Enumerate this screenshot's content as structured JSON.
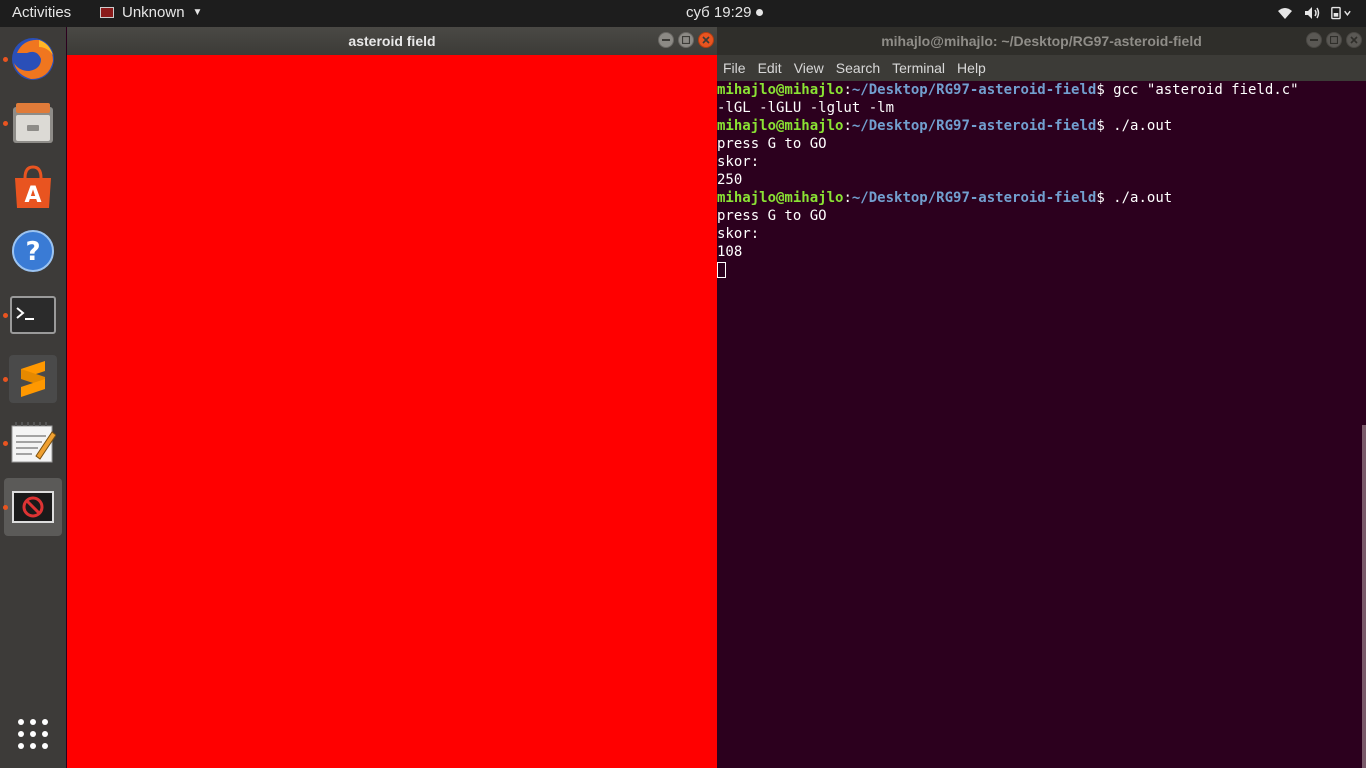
{
  "topbar": {
    "activities": "Activities",
    "app_menu_label": "Unknown",
    "clock": "суб 19:29",
    "tray_icons": [
      "wifi-icon",
      "volume-icon",
      "system-menu-icon"
    ]
  },
  "dock": {
    "items": [
      "firefox-icon",
      "files-icon",
      "software-center-icon",
      "help-icon",
      "terminal-icon",
      "sublime-text-icon",
      "text-editor-icon",
      "unknown-app-icon"
    ],
    "show_apps_icon": "app-grid-icon"
  },
  "game_window": {
    "title": "asteroid field",
    "canvas_color": "#ff0000"
  },
  "terminal": {
    "title": "mihajlo@mihajlo: ~/Desktop/RG97-asteroid-field",
    "menu": [
      "File",
      "Edit",
      "View",
      "Search",
      "Terminal",
      "Help"
    ],
    "prompt_user": "mihajlo@mihajlo",
    "prompt_sep": ":",
    "prompt_path": "~/Desktop/RG97-asteroid-field",
    "prompt_end": "$ ",
    "cmd1": "gcc \"asteroid field.c\"",
    "cmd1_cont": "-lGL -lGLU -lglut -lm",
    "cmd2": "./a.out",
    "out_press": "press G to GO",
    "out_skor": "skor:",
    "score1": "250",
    "cmd3": "./a.out",
    "score2": "108"
  },
  "colors": {
    "accent": "#e95420",
    "prompt_user": "#8ae234",
    "prompt_path": "#729fcf",
    "terminal_bg": "#2c001e"
  }
}
